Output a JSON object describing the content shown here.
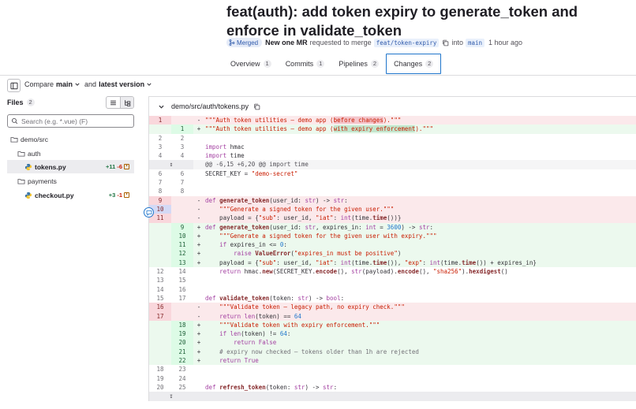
{
  "mr": {
    "title": "feat(auth): add token expiry to generate_token and enforce in validate_token",
    "status": "Merged",
    "author": "New one MR",
    "requested_text": "requested to merge",
    "source_branch": "feat/token-expiry",
    "into_text": "into",
    "target_branch": "main",
    "time": "1 hour ago"
  },
  "tabs": [
    {
      "label": "Overview",
      "count": "1"
    },
    {
      "label": "Commits",
      "count": "1"
    },
    {
      "label": "Pipelines",
      "count": "2"
    },
    {
      "label": "Changes",
      "count": "2"
    }
  ],
  "compare": {
    "label": "Compare",
    "base": "main",
    "and_text": "and",
    "head": "latest version"
  },
  "files": {
    "label": "Files",
    "count": "2",
    "search_placeholder": "Search (e.g. *.vue) (F)",
    "tree": [
      {
        "name": "demo/src",
        "type": "folder"
      },
      {
        "name": "auth",
        "type": "folder"
      },
      {
        "name": "tokens.py",
        "type": "file",
        "added": "+11",
        "removed": "-6"
      },
      {
        "name": "payments",
        "type": "folder"
      },
      {
        "name": "checkout.py",
        "type": "file",
        "added": "+3",
        "removed": "-1"
      }
    ]
  },
  "diff": {
    "path": "demo/src/auth/tokens.py",
    "hunk_header": "@@ -6,15 +6,20 @@ import time",
    "colors": {
      "deleted": "#fbe9eb",
      "added": "#ecf9ee",
      "accent": "#1f75cb"
    }
  }
}
